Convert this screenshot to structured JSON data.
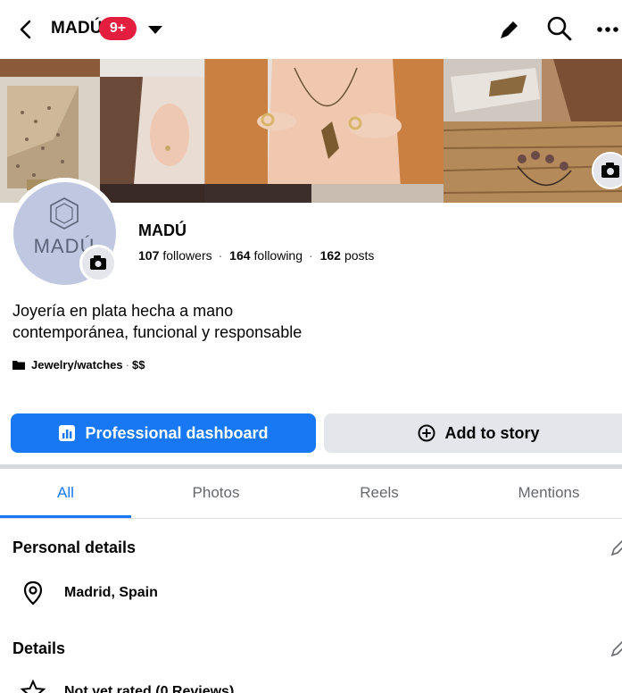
{
  "header": {
    "title": "MADÚ",
    "notification_badge": "9+"
  },
  "profile": {
    "name": "MADÚ",
    "avatar_text": "MADÚ",
    "followers_count": "107",
    "followers_label": "followers",
    "following_count": "164",
    "following_label": "following",
    "posts_count": "162",
    "posts_label": "posts",
    "bio_line1": "Joyería en plata hecha a mano",
    "bio_line2": "contemporánea, funcional y responsable",
    "category": "Jewelry/watches",
    "price": "$$"
  },
  "actions": {
    "dashboard_label": "Professional dashboard",
    "story_label": "Add to story"
  },
  "tabs": [
    {
      "label": "All",
      "active": true
    },
    {
      "label": "Photos",
      "active": false
    },
    {
      "label": "Reels",
      "active": false
    },
    {
      "label": "Mentions",
      "active": false
    }
  ],
  "personal_details": {
    "title": "Personal details",
    "location": "Madrid, Spain"
  },
  "details": {
    "title": "Details",
    "rating": "Not yet rated (0 Reviews)"
  },
  "colors": {
    "accent": "#1877f2",
    "badge": "#e41e3f",
    "secondary_button": "#e4e6eb"
  }
}
